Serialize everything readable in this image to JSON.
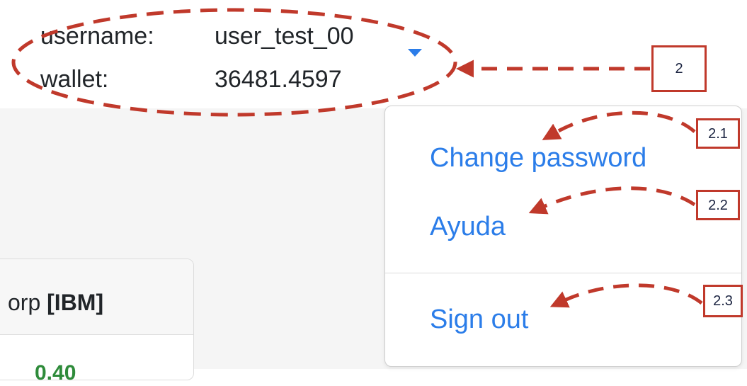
{
  "user_panel": {
    "username_label": "username:",
    "username_value": "user_test_00",
    "wallet_label": "wallet:",
    "wallet_value": "36481.4597",
    "dropdown_icon": "caret-down-icon"
  },
  "card": {
    "title_prefix": "orp ",
    "title_ticker": "[IBM]",
    "value": "0.40"
  },
  "dropdown_menu": {
    "items": [
      {
        "label": "Change password"
      },
      {
        "label": "Ayuda"
      },
      {
        "label": "Sign out"
      }
    ]
  },
  "annotations": {
    "badges": [
      "2",
      "2.1",
      "2.2",
      "2.3"
    ],
    "color": "#c0392b"
  },
  "colors": {
    "link": "#2b7de9",
    "positive": "#2e8b3a",
    "annotation": "#c0392b"
  }
}
